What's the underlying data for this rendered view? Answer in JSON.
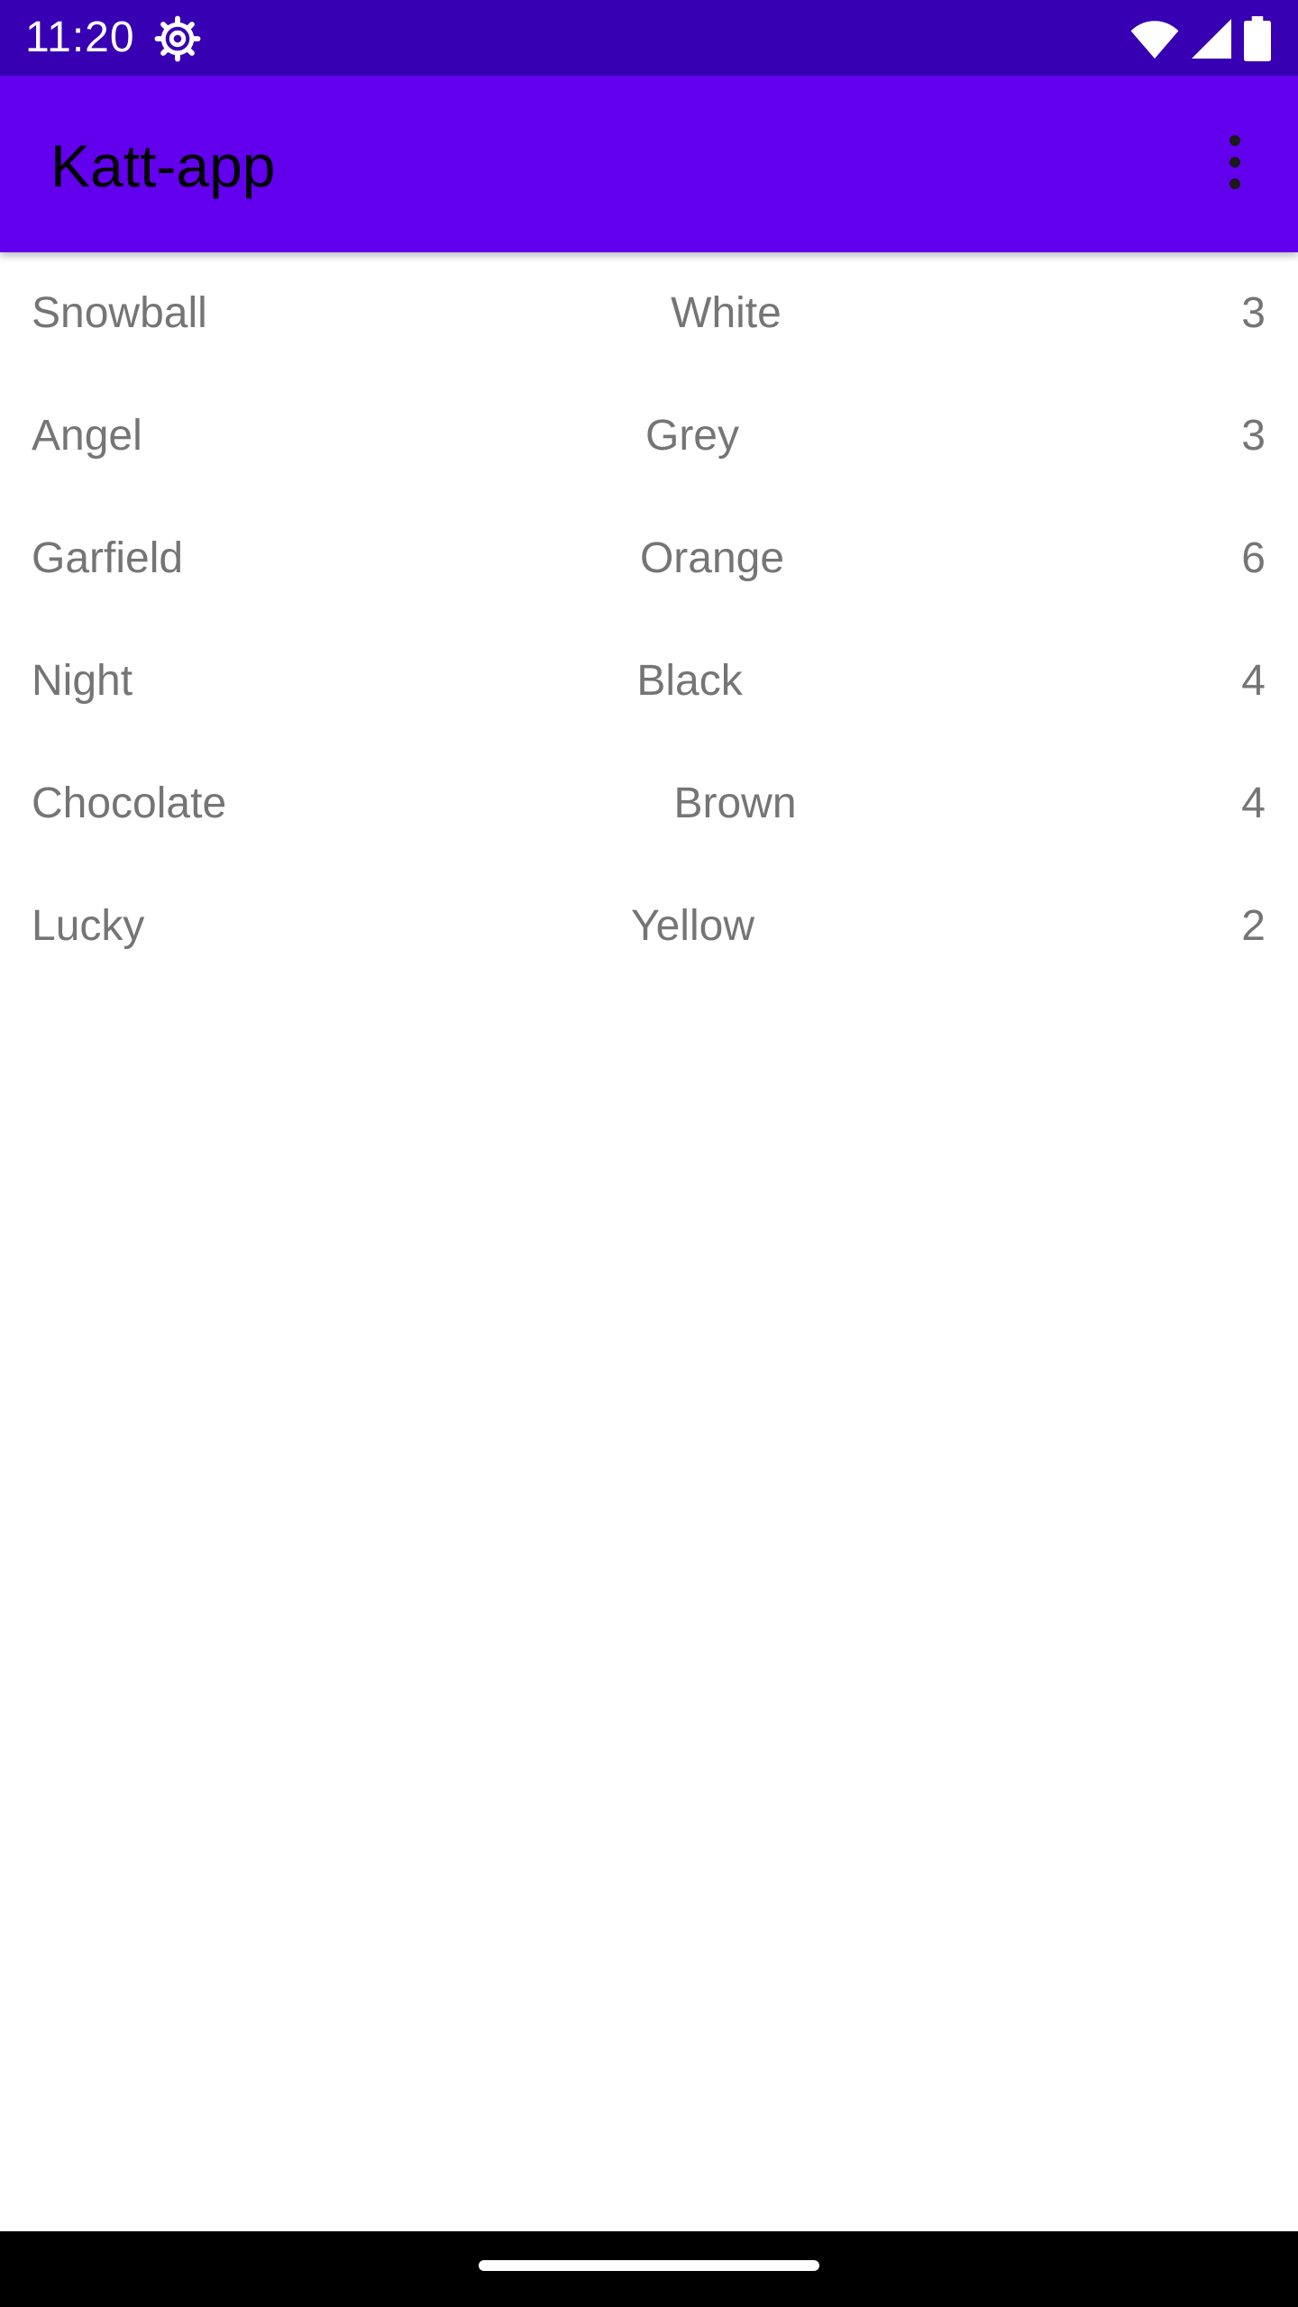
{
  "status_bar": {
    "time": "11:20",
    "background": "#3700b3",
    "icons": [
      "settings-icon",
      "wifi-icon",
      "cell-signal-icon",
      "battery-icon"
    ]
  },
  "app_bar": {
    "title": "Katt-app",
    "background": "#6200ee",
    "menu_icon": "more-vert-icon"
  },
  "cats": [
    {
      "name": "Snowball",
      "color": "White",
      "age": "3"
    },
    {
      "name": "Angel",
      "color": "Grey",
      "age": "3"
    },
    {
      "name": "Garfield",
      "color": "Orange",
      "age": "6"
    },
    {
      "name": "Night",
      "color": "Black",
      "age": "4"
    },
    {
      "name": "Chocolate",
      "color": "Brown",
      "age": "4"
    },
    {
      "name": "Lucky",
      "color": "Yellow",
      "age": "2"
    }
  ],
  "text_color": "#757575",
  "nav_bar": {
    "handle": "home-handle"
  }
}
